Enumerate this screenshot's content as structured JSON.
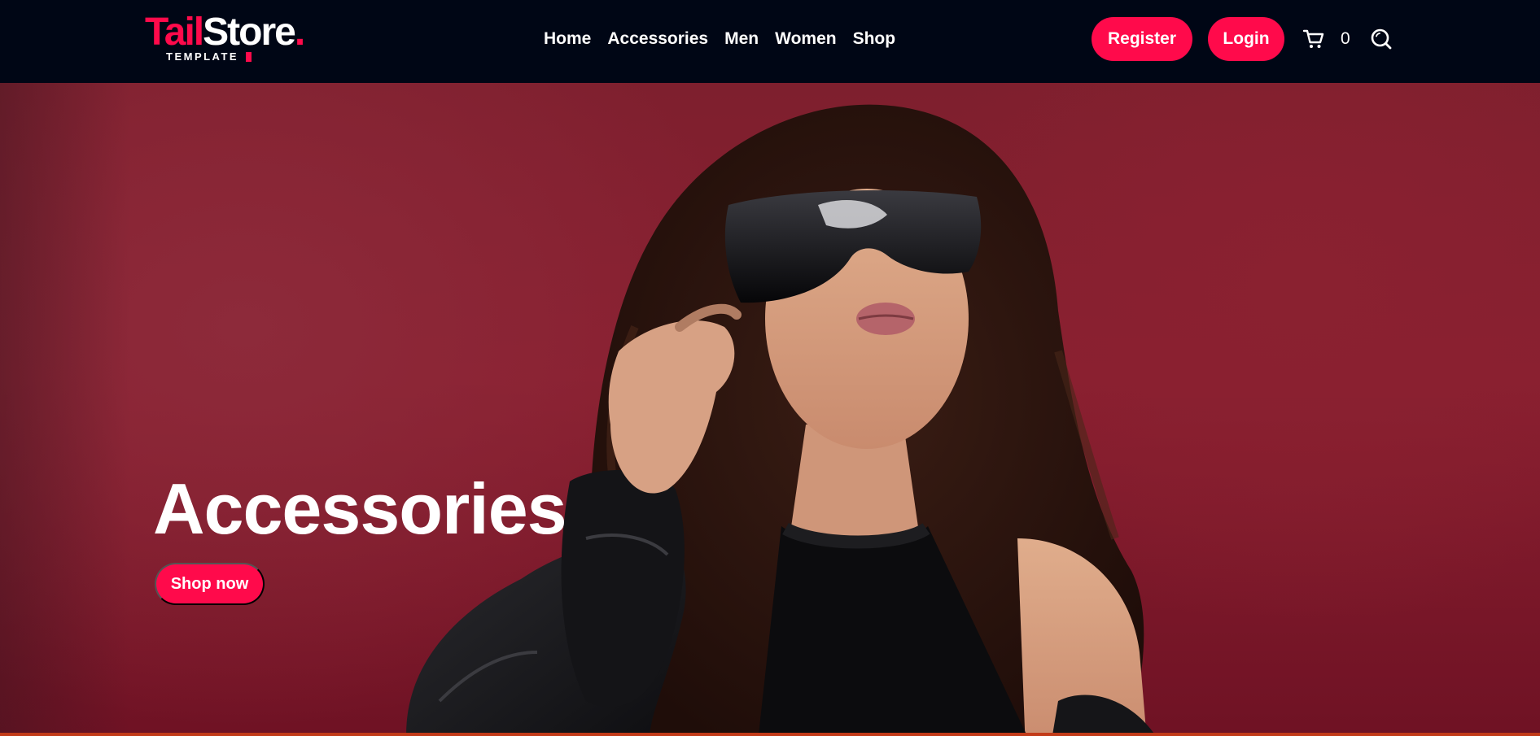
{
  "brand": {
    "name_accent": "Tail",
    "name_main": "Store",
    "name_dot": ".",
    "subtitle": "TEMPLATE",
    "color_accent": "#ff0a4b",
    "color_header": "#000615"
  },
  "nav": {
    "items": [
      {
        "label": "Home"
      },
      {
        "label": "Accessories"
      },
      {
        "label": "Men"
      },
      {
        "label": "Women"
      },
      {
        "label": "Shop"
      }
    ]
  },
  "header": {
    "register_label": "Register",
    "login_label": "Login",
    "cart_icon": "cart-icon",
    "cart_count": "0",
    "search_icon": "search-icon"
  },
  "hero": {
    "title": "Accessories",
    "cta_label": "Shop now",
    "image_subject": "woman wearing black shield sunglasses and leather jacket on red background"
  }
}
